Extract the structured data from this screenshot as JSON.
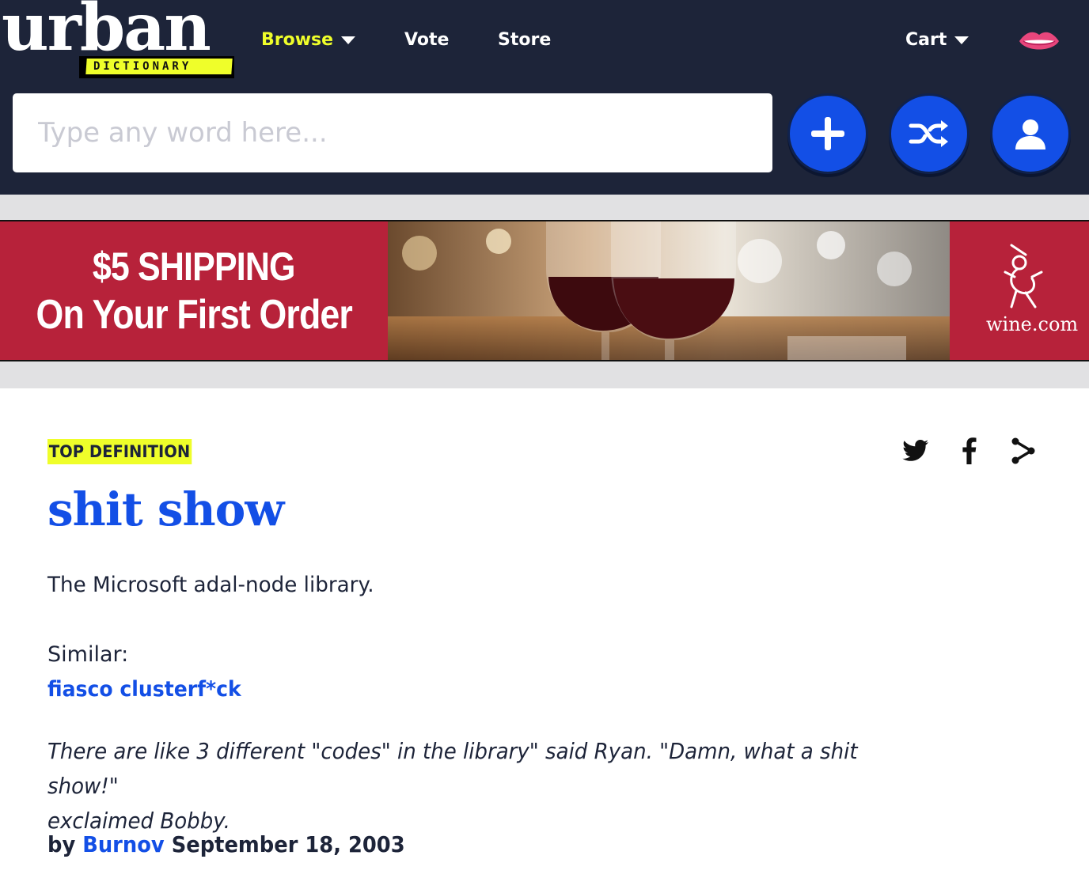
{
  "header": {
    "logo_word": "urban",
    "logo_tag": "DICTIONARY",
    "nav": {
      "browse": "Browse",
      "vote": "Vote",
      "store": "Store",
      "cart": "Cart"
    },
    "search": {
      "placeholder": "Type any word here..."
    },
    "icons": {
      "add": "plus-icon",
      "random": "shuffle-icon",
      "account": "user-icon",
      "brand": "lips-icon",
      "dropdown": "chevron-down-icon"
    },
    "colors": {
      "background": "#1d2439",
      "accent_yellow": "#effe2a",
      "button_blue": "#134fe6"
    }
  },
  "ad": {
    "line1": "$5 SHIPPING",
    "line2": "On Your First Order",
    "brand": "wine.com",
    "background": "#b7223a"
  },
  "definition": {
    "badge": "TOP DEFINITION",
    "word": "shit show",
    "meaning": "The Microsoft adal-node library.",
    "similar_label": "Similar:",
    "similar": [
      "fiasco",
      "clusterf*ck"
    ],
    "example_line1": "There are like 3 different \"codes\" in the library\" said Ryan. \"Damn, what a shit show!\"",
    "example_line2": "exclaimed Bobby.",
    "by_label": "by",
    "author": "Burnov",
    "date": "September 18, 2003",
    "share_icons": [
      "twitter-icon",
      "facebook-icon",
      "share-icon"
    ],
    "link_color": "#134fe6"
  }
}
